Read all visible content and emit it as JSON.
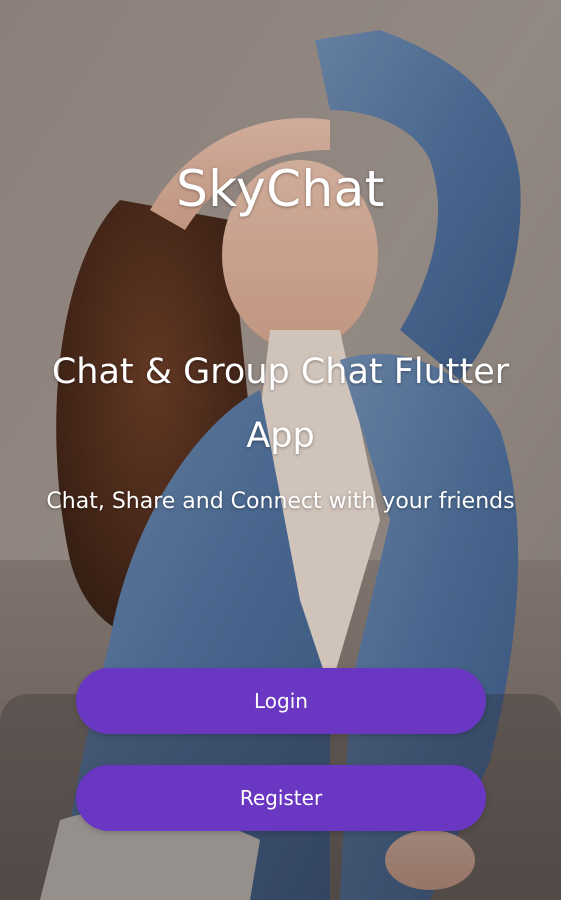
{
  "app": {
    "title": "SkyChat"
  },
  "hero": {
    "headline": "Chat & Group Chat Flutter App",
    "subheadline": "Chat, Share and Connect with your friends"
  },
  "actions": {
    "login_label": "Login",
    "register_label": "Register"
  },
  "colors": {
    "button_background": "#6a37c2",
    "text": "#ffffff"
  }
}
